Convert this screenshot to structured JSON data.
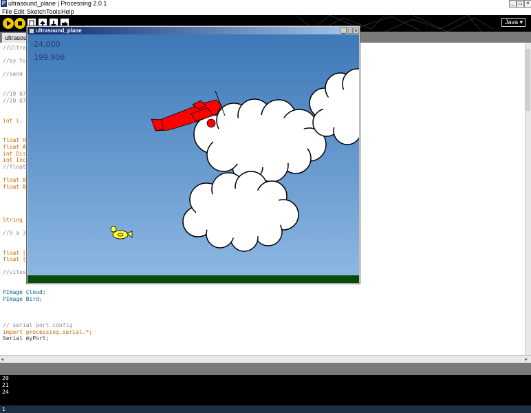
{
  "window": {
    "title": "ultrasound_plane | Processing 2.0.1",
    "app_icon": "P"
  },
  "menu": [
    "File",
    "Edit",
    "Sketch",
    "Tools",
    "Help"
  ],
  "toolbar": {
    "mode": "Java ▾"
  },
  "tab": {
    "label": "ultrasound_plane"
  },
  "code": [
    {
      "text": "//Ultras",
      "cls": "cm"
    },
    {
      "text": ""
    },
    {
      "text": "//by Yor",
      "cls": "cm"
    },
    {
      "text": ""
    },
    {
      "text": "//send c",
      "cls": "cm"
    },
    {
      "text": ""
    },
    {
      "text": ""
    },
    {
      "text": "//19 07",
      "cls": "cm"
    },
    {
      "text": "//20 07",
      "cls": "cm"
    },
    {
      "text": ""
    },
    {
      "text": ""
    },
    {
      "text": "int i, j",
      "cls": "kw"
    },
    {
      "text": ""
    },
    {
      "text": ""
    },
    {
      "text": "float Ha",
      "cls": "kw"
    },
    {
      "text": "float An",
      "cls": "kw"
    },
    {
      "text": "int Dist",
      "cls": "kw"
    },
    {
      "text": "int Inco",
      "cls": "kw"
    },
    {
      "text": "//float",
      "cls": "cm"
    },
    {
      "text": ""
    },
    {
      "text": "float Bi",
      "cls": "kw"
    },
    {
      "text": "float Bi",
      "cls": "kw"
    },
    {
      "text": ""
    },
    {
      "text": ""
    },
    {
      "text": ""
    },
    {
      "text": ""
    },
    {
      "text": "String D",
      "cls": "kw"
    },
    {
      "text": ""
    },
    {
      "text": "//5 a 32",
      "cls": "cm"
    },
    {
      "text": ""
    },
    {
      "text": ""
    },
    {
      "text": "float []",
      "cls": "kw"
    },
    {
      "text": "float []",
      "cls": "kw"
    },
    {
      "text": ""
    },
    {
      "text": "//vitess",
      "cls": "cm"
    },
    {
      "text": ""
    },
    {
      "text": ""
    },
    {
      "text": "PImage Cloud;",
      "cls": "ty"
    },
    {
      "text": "PImage Bird;",
      "cls": "ty"
    },
    {
      "text": ""
    },
    {
      "text": ""
    },
    {
      "text": ""
    },
    {
      "text": "// serial port config",
      "cls": "cm"
    },
    {
      "text": "import processing.serial.*;",
      "cls": "kw"
    },
    {
      "text": "Serial myPort;"
    }
  ],
  "console": [
    "20",
    "21",
    "24"
  ],
  "status": {
    "line": "1"
  },
  "sketch": {
    "title": "ultrasound_plane",
    "readout1": "-24,000",
    "readout2": "199,906"
  },
  "colors": {
    "sky_top": "#3d78b8",
    "sky_bottom": "#8fb9e3",
    "ground": "#0a4a0a",
    "plane": "#ff0000",
    "bird": "#ffff33",
    "cloud": "#ffffff"
  }
}
